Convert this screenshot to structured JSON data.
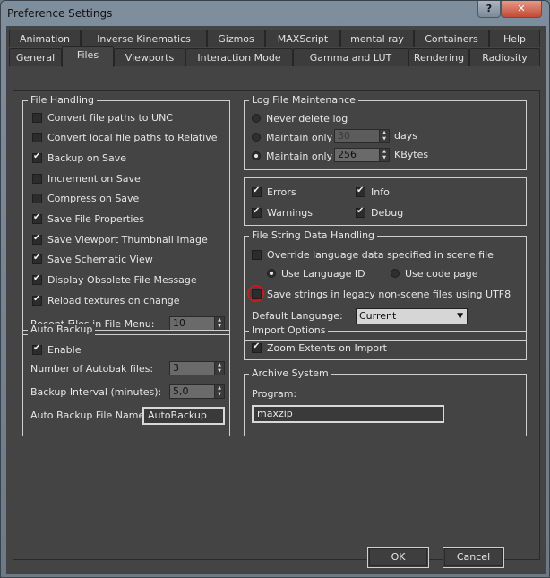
{
  "window": {
    "title": "Preference Settings",
    "help_label": "?",
    "close_label": "✕"
  },
  "tabs_row1": [
    "Animation",
    "Inverse Kinematics",
    "Gizmos",
    "MAXScript",
    "mental ray",
    "Containers",
    "Help"
  ],
  "tabs_row2": [
    "General",
    "Files",
    "Viewports",
    "Interaction Mode",
    "Gamma and LUT",
    "Rendering",
    "Radiosity"
  ],
  "active_tab": "Files",
  "file_handling": {
    "title": "File Handling",
    "options": [
      {
        "label": "Convert file paths to UNC",
        "checked": false
      },
      {
        "label": "Convert local file paths to Relative",
        "checked": false
      },
      {
        "label": "Backup on Save",
        "checked": true
      },
      {
        "label": "Increment on Save",
        "checked": false
      },
      {
        "label": "Compress on Save",
        "checked": false
      },
      {
        "label": "Save File Properties",
        "checked": true
      },
      {
        "label": "Save Viewport Thumbnail Image",
        "checked": true
      },
      {
        "label": "Save Schematic View",
        "checked": true
      },
      {
        "label": "Display Obsolete File Message",
        "checked": true
      },
      {
        "label": "Reload textures on change",
        "checked": true
      }
    ],
    "recent_files_label": "Recent Files in File Menu:",
    "recent_files_value": "10"
  },
  "log_file": {
    "title": "Log File Maintenance",
    "never_delete": "Never delete log",
    "maintain_days_label": "Maintain only",
    "maintain_days_value": "30",
    "days_unit": "days",
    "maintain_kb_label": "Maintain only",
    "maintain_kb_value": "256",
    "kb_unit": "KBytes",
    "selected": "kbytes"
  },
  "log_flags": [
    {
      "label": "Errors",
      "checked": true
    },
    {
      "label": "Info",
      "checked": true
    },
    {
      "label": "Warnings",
      "checked": true
    },
    {
      "label": "Debug",
      "checked": true
    }
  ],
  "file_string": {
    "title": "File String Data Handling",
    "override_label": "Override language data specified in scene file",
    "override_checked": false,
    "use_language_id": "Use Language ID",
    "use_code_page": "Use code page",
    "utf8_label": "Save strings in legacy non-scene files using UTF8",
    "utf8_checked": false,
    "default_language_label": "Default Language:",
    "default_language_value": "Current"
  },
  "auto_backup": {
    "title": "Auto Backup",
    "enable_label": "Enable",
    "enable_checked": true,
    "num_files_label": "Number of Autobak files:",
    "num_files_value": "3",
    "interval_label": "Backup Interval (minutes):",
    "interval_value": "5,0",
    "filename_label": "Auto Backup File Name:",
    "filename_value": "AutoBackup"
  },
  "import_options": {
    "title": "Import Options",
    "zoom_label": "Zoom Extents on Import",
    "zoom_checked": true
  },
  "archive": {
    "title": "Archive System",
    "program_label": "Program:",
    "program_value": "maxzip"
  },
  "buttons": {
    "ok": "OK",
    "cancel": "Cancel"
  }
}
